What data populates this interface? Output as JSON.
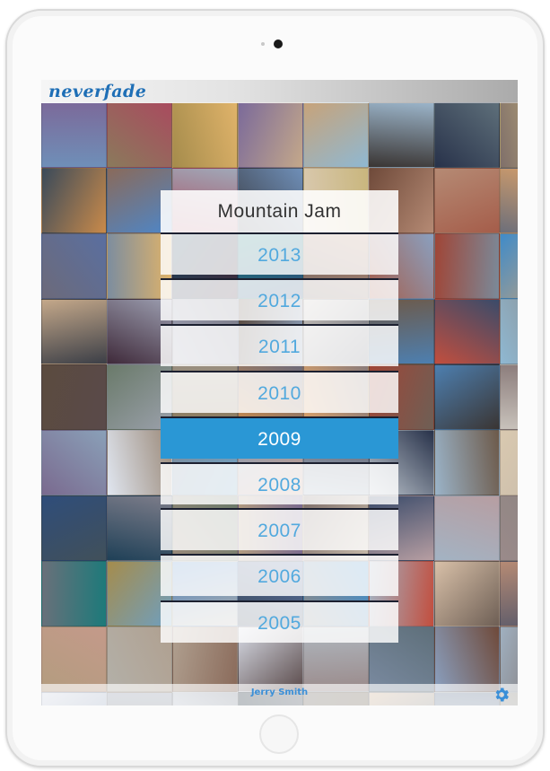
{
  "app": {
    "logo_text": "neverfade"
  },
  "picker": {
    "title": "Mountain Jam",
    "years": [
      "2013",
      "2012",
      "2011",
      "2010",
      "2009",
      "2008",
      "2007",
      "2006",
      "2005"
    ],
    "selected_year": "2009"
  },
  "footer": {
    "username": "Jerry Smith",
    "settings_icon": "gear-icon"
  },
  "colors": {
    "accent": "#2a97d5",
    "year_text": "#52a9de",
    "logo": "#1f6fb6",
    "username": "#3a8fd8"
  },
  "mosaic_tile_colors": [
    "#6f8fb8",
    "#8a7a5c",
    "#a58c4c",
    "#7b6a9a",
    "#c7a37a",
    "#9bb4c9",
    "#5e6f7a",
    "#c9b67d",
    "#c98a4a",
    "#4e86c7",
    "#a94b5e",
    "#3c3f47",
    "#d9c9b0",
    "#6f4a3a",
    "#b58a74",
    "#d8a06a",
    "#5a6fa0",
    "#e0b36a",
    "#3f2a3a",
    "#2f4d7a",
    "#7a6a64",
    "#a55d4a",
    "#a04536",
    "#3f8bc9",
    "#c4a88a",
    "#9c9eb0",
    "#7d7d8a",
    "#8a9bb5",
    "#6d6f7a",
    "#4d7fb0",
    "#c24e3e",
    "#8fb8d2",
    "#5b4b3f",
    "#6a7a6a",
    "#9a8f80",
    "#6c6a7a",
    "#8a7b7a",
    "#6e5f55",
    "#3a3533",
    "#c8c2bb",
    "#7a6a8f",
    "#e0e6f0",
    "#7c8d9f",
    "#8aa0b8",
    "#5a5a6a",
    "#28324a",
    "#6d5a4a",
    "#c6b9a9",
    "#41505a",
    "#1f4057",
    "#9b8a7a",
    "#b39c7f",
    "#7f6f6a",
    "#3a4b6a",
    "#b79ea2",
    "#8b8480",
    "#1c7a7a",
    "#6f9fbf",
    "#b3b0a8",
    "#3a4a5a",
    "#8a8a8a",
    "#a3b3c3",
    "#d8c0a8",
    "#b58a74",
    "#c49a8a",
    "#b0a090",
    "#8a6a5a",
    "#5a4a4a",
    "#9a8a8a",
    "#7a8aa0",
    "#8aa0c0",
    "#a0b0c0",
    "#d8dce6",
    "#a0a8b8",
    "#9aa0aa",
    "#6a707a",
    "#8a8070",
    "#7a8a9a",
    "#c0c8d0",
    "#b0b8c0"
  ]
}
